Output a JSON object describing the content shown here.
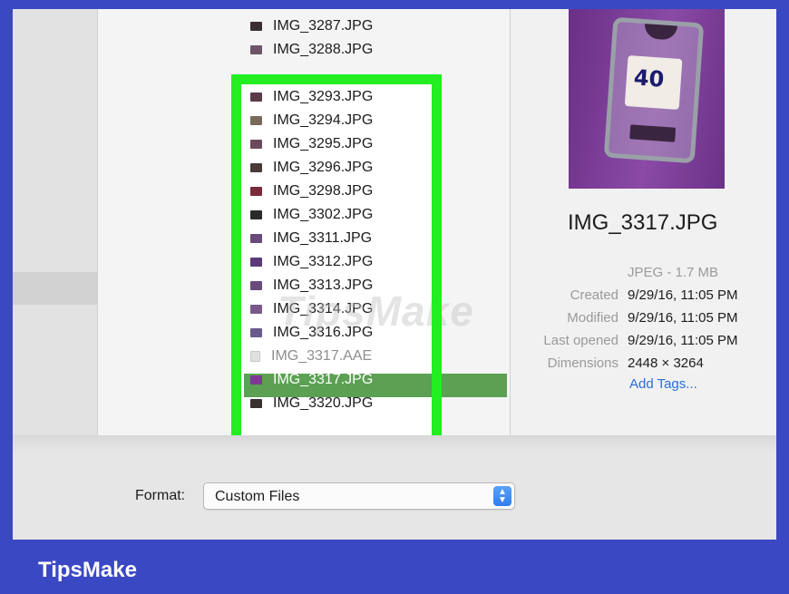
{
  "files": [
    {
      "name": "IMG_3287.JPG",
      "icon": "image-file-icon",
      "color": "#3a2e33",
      "state": "normal"
    },
    {
      "name": "IMG_3288.JPG",
      "icon": "image-file-icon",
      "color": "#6b5566",
      "state": "normal"
    },
    {
      "name": "IMG_3293.JPG",
      "icon": "image-file-icon",
      "color": "#5b3a4a",
      "state": "normal"
    },
    {
      "name": "IMG_3294.JPG",
      "icon": "image-file-icon",
      "color": "#7a6a5a",
      "state": "normal"
    },
    {
      "name": "IMG_3295.JPG",
      "icon": "image-file-icon",
      "color": "#6a4a5a",
      "state": "normal"
    },
    {
      "name": "IMG_3296.JPG",
      "icon": "image-file-icon",
      "color": "#4a3a3a",
      "state": "normal"
    },
    {
      "name": "IMG_3298.JPG",
      "icon": "image-file-icon",
      "color": "#7a2a3a",
      "state": "normal"
    },
    {
      "name": "IMG_3302.JPG",
      "icon": "image-file-icon",
      "color": "#2a2a2a",
      "state": "normal"
    },
    {
      "name": "IMG_3311.JPG",
      "icon": "image-file-icon",
      "color": "#6a4a7a",
      "state": "normal"
    },
    {
      "name": "IMG_3312.JPG",
      "icon": "image-file-icon",
      "color": "#5a3a7a",
      "state": "normal"
    },
    {
      "name": "IMG_3313.JPG",
      "icon": "image-file-icon",
      "color": "#6a4a7a",
      "state": "normal"
    },
    {
      "name": "IMG_3314.JPG",
      "icon": "image-file-icon",
      "color": "#7a5a8a",
      "state": "normal"
    },
    {
      "name": "IMG_3316.JPG",
      "icon": "image-file-icon",
      "color": "#6a5a8a",
      "state": "normal"
    },
    {
      "name": "IMG_3317.AAE",
      "icon": "document-file-icon",
      "color": "#e0e0e0",
      "state": "dim"
    },
    {
      "name": "IMG_3317.JPG",
      "icon": "image-file-icon",
      "color": "#7a3a9a",
      "state": "selected"
    },
    {
      "name": "IMG_3320.JPG",
      "icon": "image-file-icon",
      "color": "#3a3030",
      "state": "normal"
    }
  ],
  "preview": {
    "name": "IMG_3317.JPG",
    "type_size": "JPEG - 1.7 MB",
    "meta": [
      {
        "label": "Created",
        "value": "9/29/16, 11:05 PM"
      },
      {
        "label": "Modified",
        "value": "9/29/16, 11:05 PM"
      },
      {
        "label": "Last opened",
        "value": "9/29/16, 11:05 PM"
      },
      {
        "label": "Dimensions",
        "value": "2448 × 3264"
      }
    ],
    "add_tags": "Add Tags...",
    "sticker_text": "40"
  },
  "format": {
    "label": "Format:",
    "value": "Custom Files",
    "stepper": "⌃⌄"
  },
  "watermark": "TipsMake",
  "brand": "TipsMake",
  "colors": {
    "frame": "#3b48c4",
    "highlight_box": "#22ee22",
    "selection": "#5ba053",
    "link": "#2b6ed8"
  }
}
